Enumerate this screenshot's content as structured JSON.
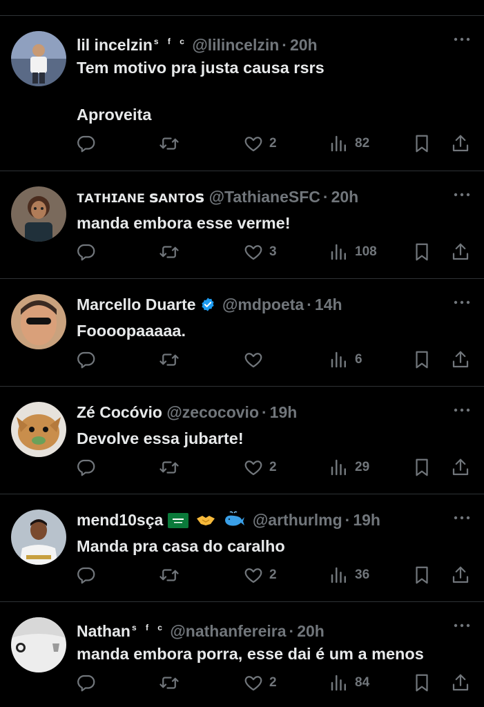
{
  "tweets": [
    {
      "name": "lil incelzin",
      "name_suffix": "s f c",
      "handle": "@lilincelzin",
      "separator": "·",
      "time": "20h",
      "text": "Tem motivo pra justa causa rsrs\n\nAproveita",
      "replies": "",
      "retweets": "",
      "likes": "2",
      "views": "82"
    },
    {
      "name": "ᴛᴀᴛʜɪᴀɴᴇ ꜱᴀɴᴛᴏꜱ",
      "name_suffix": "",
      "handle": "@TathianeSFC",
      "separator": "·",
      "time": "20h",
      "text": "manda embora esse verme!",
      "replies": "",
      "retweets": "",
      "likes": "3",
      "views": "108"
    },
    {
      "name": "Marcello Duarte",
      "name_suffix": "",
      "verified": true,
      "handle": "@mdpoeta",
      "separator": "·",
      "time": "14h",
      "text": "Foooораaaaa.",
      "replies": "",
      "retweets": "",
      "likes": "",
      "views": "6"
    },
    {
      "name": "Zé Cocóvio",
      "name_suffix": "",
      "handle": "@zecocovio",
      "separator": "·",
      "time": "19h",
      "text": "Devolve essa jubarte!",
      "replies": "",
      "retweets": "",
      "likes": "2",
      "views": "29"
    },
    {
      "name": "mend10sça",
      "name_suffix": "",
      "emojis": [
        "saudi-flag-icon",
        "handshake-icon",
        "whale-icon"
      ],
      "handle": "@arthurlmg",
      "separator": "·",
      "time": "19h",
      "text": "Manda pra casa do caralho",
      "replies": "",
      "retweets": "",
      "likes": "2",
      "views": "36"
    },
    {
      "name": "Nathan",
      "name_suffix": "s f c",
      "handle": "@nathanfereira",
      "separator": "·",
      "time": "20h",
      "text": "manda embora porra, esse dai é um a menos",
      "replies": "",
      "retweets": "",
      "likes": "2",
      "views": "84"
    }
  ],
  "colors": {
    "background": "#000000",
    "text": "#e7e9ea",
    "muted": "#71767b",
    "divider": "#2f3336",
    "verified": "#1d9bf0"
  }
}
